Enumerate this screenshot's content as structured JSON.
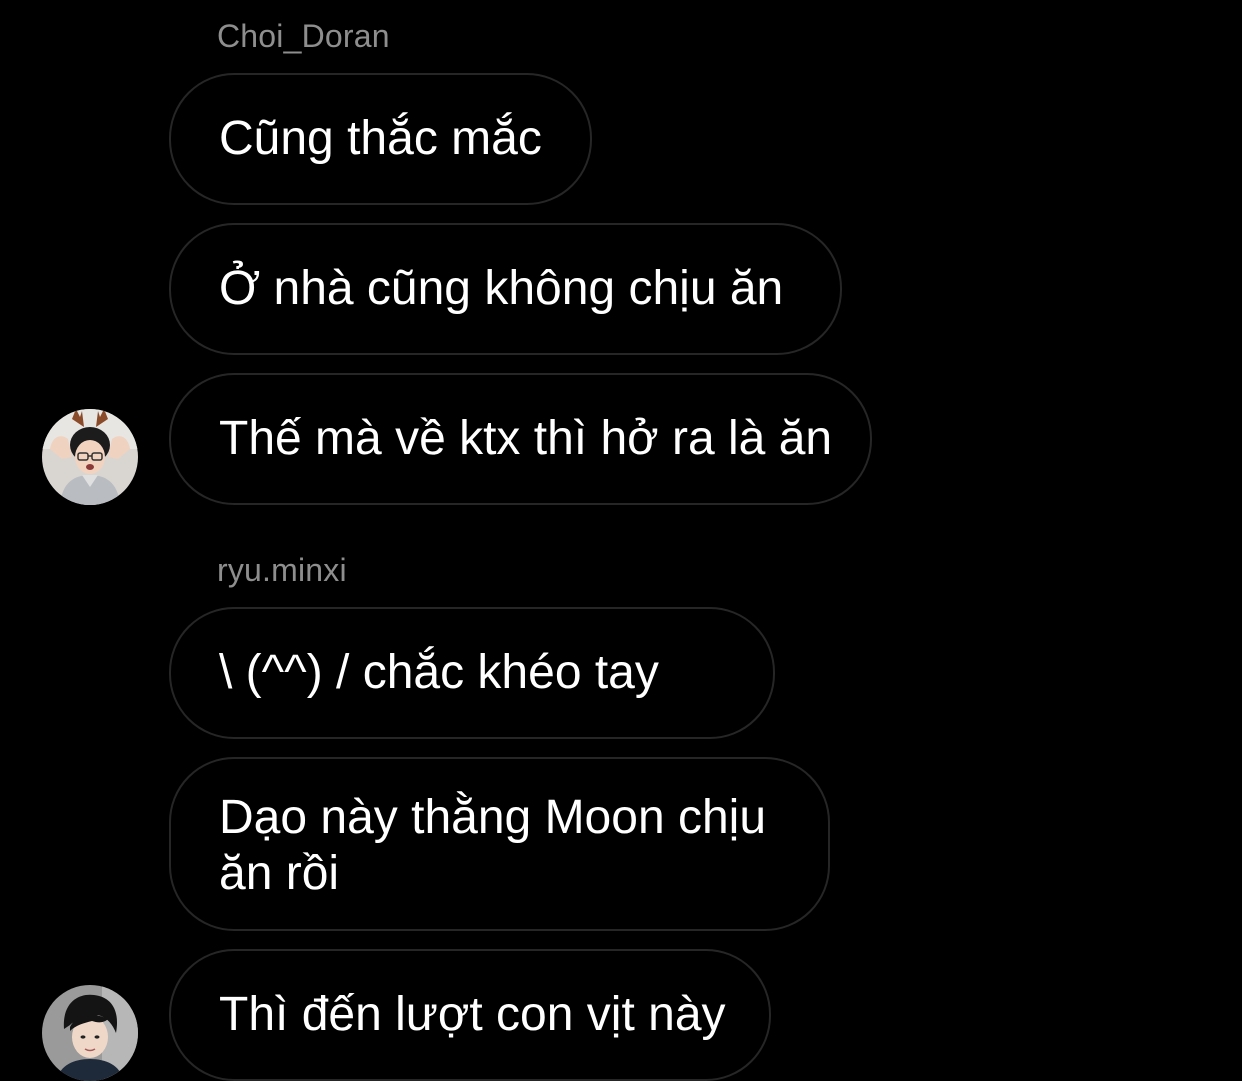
{
  "thread": {
    "groups": [
      {
        "sender": "Choi_Doran",
        "avatar_icon": "avatar-boy-antlers-icon",
        "messages": [
          "Cũng thắc mắc",
          "Ở nhà cũng không chịu ăn",
          "Thế mà về ktx thì hở ra là ăn"
        ]
      },
      {
        "sender": "ryu.minxi",
        "avatar_icon": "avatar-dark-hair-icon",
        "messages": [
          "\\ (^^) / chắc khéo tay",
          "Dạo này thằng Moon chịu\năn rồi",
          "Thì đến lượt con vịt này"
        ]
      }
    ]
  },
  "colors": {
    "background": "#000000",
    "bubble_border": "#262626",
    "sender_text": "#8e8e8e",
    "message_text": "#ffffff"
  }
}
